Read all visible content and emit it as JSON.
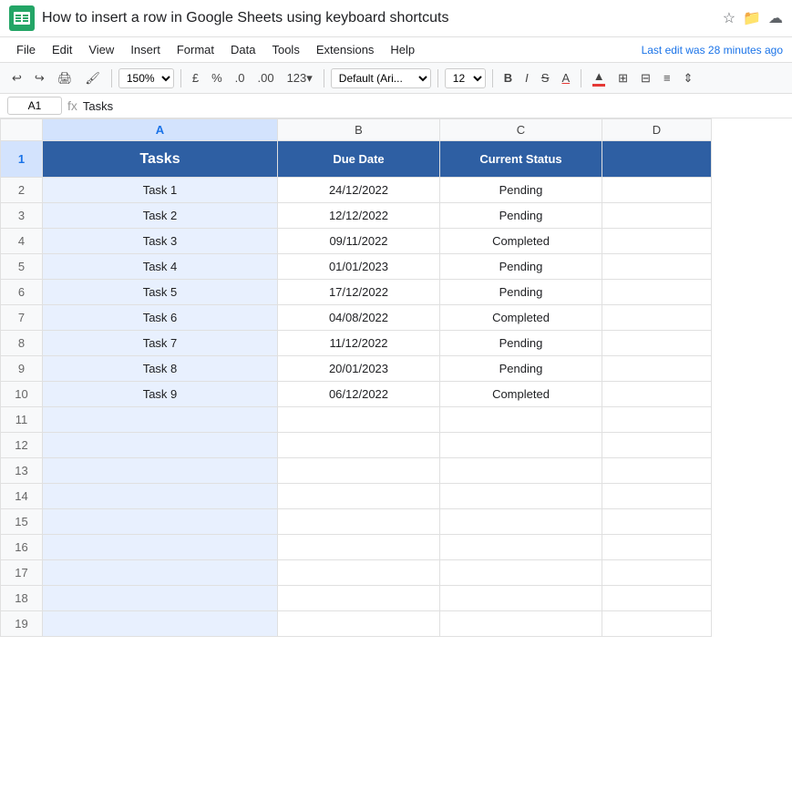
{
  "titleBar": {
    "title": "How to insert a row in Google Sheets using keyboard shortcuts",
    "lastEdit": "Last edit was 28 minutes ago",
    "icons": [
      "star",
      "folder",
      "cloud"
    ]
  },
  "menuBar": {
    "items": [
      "File",
      "Edit",
      "View",
      "Insert",
      "Format",
      "Data",
      "Tools",
      "Extensions",
      "Help"
    ]
  },
  "toolbar": {
    "undo": "↩",
    "redo": "↪",
    "print": "🖨",
    "paintFormat": "🖌",
    "zoom": "150%",
    "currency": "£",
    "percent": "%",
    "decimal0": ".0",
    "decimal00": ".00",
    "moreFormats": "123▾",
    "font": "Default (Ari...",
    "fontSize": "12",
    "bold": "B",
    "italic": "I",
    "strikethrough": "S",
    "textColor": "A",
    "fillColor": "▲",
    "borders": "⊞",
    "mergeAlignIcon": "⊟",
    "alignIcon": "≡",
    "moreIcon": "⇕"
  },
  "formulaBar": {
    "cellRef": "A1",
    "fxSymbol": "fx",
    "value": "Tasks"
  },
  "columnHeaders": [
    "A",
    "B",
    "C",
    "D"
  ],
  "rows": [
    {
      "rowNum": "1",
      "cells": [
        "Tasks",
        "Due Date",
        "Current Status",
        ""
      ],
      "isHeader": true
    },
    {
      "rowNum": "2",
      "cells": [
        "Task 1",
        "24/12/2022",
        "Pending",
        ""
      ],
      "isHeader": false
    },
    {
      "rowNum": "3",
      "cells": [
        "Task 2",
        "12/12/2022",
        "Pending",
        ""
      ],
      "isHeader": false
    },
    {
      "rowNum": "4",
      "cells": [
        "Task 3",
        "09/11/2022",
        "Completed",
        ""
      ],
      "isHeader": false
    },
    {
      "rowNum": "5",
      "cells": [
        "Task 4",
        "01/01/2023",
        "Pending",
        ""
      ],
      "isHeader": false
    },
    {
      "rowNum": "6",
      "cells": [
        "Task 5",
        "17/12/2022",
        "Pending",
        ""
      ],
      "isHeader": false
    },
    {
      "rowNum": "7",
      "cells": [
        "Task 6",
        "04/08/2022",
        "Completed",
        ""
      ],
      "isHeader": false
    },
    {
      "rowNum": "8",
      "cells": [
        "Task 7",
        "11/12/2022",
        "Pending",
        ""
      ],
      "isHeader": false
    },
    {
      "rowNum": "9",
      "cells": [
        "Task 8",
        "20/01/2023",
        "Pending",
        ""
      ],
      "isHeader": false
    },
    {
      "rowNum": "10",
      "cells": [
        "Task 9",
        "06/12/2022",
        "Completed",
        ""
      ],
      "isHeader": false
    },
    {
      "rowNum": "11",
      "cells": [
        "",
        "",
        "",
        ""
      ],
      "isHeader": false
    },
    {
      "rowNum": "12",
      "cells": [
        "",
        "",
        "",
        ""
      ],
      "isHeader": false
    },
    {
      "rowNum": "13",
      "cells": [
        "",
        "",
        "",
        ""
      ],
      "isHeader": false
    },
    {
      "rowNum": "14",
      "cells": [
        "",
        "",
        "",
        ""
      ],
      "isHeader": false
    },
    {
      "rowNum": "15",
      "cells": [
        "",
        "",
        "",
        ""
      ],
      "isHeader": false
    },
    {
      "rowNum": "16",
      "cells": [
        "",
        "",
        "",
        ""
      ],
      "isHeader": false
    },
    {
      "rowNum": "17",
      "cells": [
        "",
        "",
        "",
        ""
      ],
      "isHeader": false
    },
    {
      "rowNum": "18",
      "cells": [
        "",
        "",
        "",
        ""
      ],
      "isHeader": false
    },
    {
      "rowNum": "19",
      "cells": [
        "",
        "",
        "",
        ""
      ],
      "isHeader": false
    }
  ],
  "colors": {
    "headerBg": "#2e5fa3",
    "headerText": "#ffffff",
    "selectedColBg": "#e8f0fe",
    "selectedHeaderBg": "#d3e3fd",
    "borderColor": "#e0e0e0",
    "sheetBg": "#f8f9fa"
  }
}
